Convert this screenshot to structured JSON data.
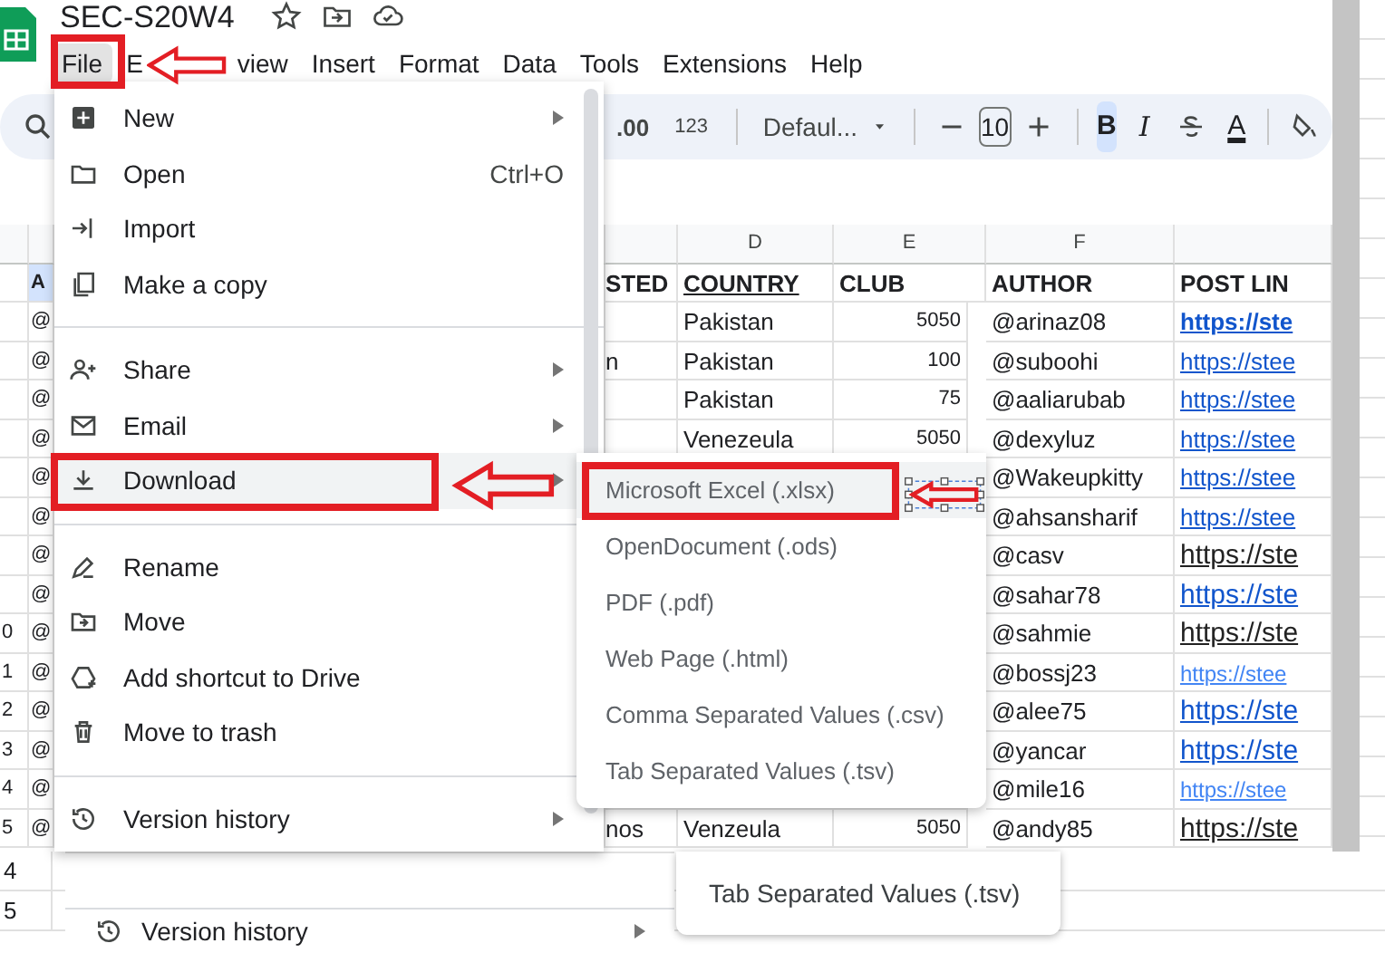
{
  "app": {
    "title": "SEC-S20W4"
  },
  "menu_bar": [
    {
      "label": "File",
      "selected": true
    },
    {
      "label": "E",
      "selected": false
    },
    {
      "label": "view",
      "selected": false
    },
    {
      "label": "Insert",
      "selected": false
    },
    {
      "label": "Format",
      "selected": false
    },
    {
      "label": "Data",
      "selected": false
    },
    {
      "label": "Tools",
      "selected": false
    },
    {
      "label": "Extensions",
      "selected": false
    },
    {
      "label": "Help",
      "selected": false
    }
  ],
  "toolbar": {
    "decimal_label": ".00",
    "number_format": "123",
    "font": "Defaul...",
    "font_size": "10",
    "bold": {
      "label": "B",
      "on": true
    },
    "italic_label": "I",
    "text_color_label": "A"
  },
  "sheet": {
    "columns": [
      "D",
      "E",
      "F"
    ],
    "header": {
      "a": "A",
      "c": "STED",
      "d": "COUNTRY",
      "e": "CLUB",
      "f": "AUTHOR",
      "g": "POST LIN"
    },
    "rows": [
      {
        "a": "@",
        "d": "Pakistan",
        "e": "5050",
        "f": "@arinaz08",
        "g": "https://ste",
        "kind": "bold-link"
      },
      {
        "a": "@",
        "c": "n",
        "d": "Pakistan",
        "e": "100",
        "f": "@suboohi",
        "g": "https://stee",
        "kind": "link"
      },
      {
        "a": "@",
        "d": "Pakistan",
        "e": "75",
        "f": "@aaliarubab",
        "g": "https://stee",
        "kind": "link"
      },
      {
        "a": "@",
        "d": "Venezeula",
        "e": "5050",
        "f": "@dexyluz",
        "g": "https://stee",
        "kind": "link"
      },
      {
        "a": "@",
        "f": "@Wakeupkitty",
        "g": "https://stee",
        "kind": "link"
      },
      {
        "a": "@",
        "f": "@ahsansharif",
        "g": "https://stee",
        "kind": "link"
      },
      {
        "a": "@",
        "f": "@casv",
        "g": "https://ste",
        "kind": "large-dark"
      },
      {
        "a": "@",
        "f": "@sahar78",
        "g": "https://ste",
        "kind": "large-link"
      },
      {
        "a": "@",
        "row_num": "0",
        "f": "@sahmie",
        "g": "https://ste",
        "kind": "large-dark"
      },
      {
        "a": "@",
        "row_num": "1",
        "f": "@bossj23",
        "g": "https://stee",
        "kind": "small-link"
      },
      {
        "a": "@",
        "row_num": "2",
        "f": "@alee75",
        "g": "https://ste",
        "kind": "large-link"
      },
      {
        "a": "@",
        "row_num": "3",
        "f": "@yancar",
        "g": "https://ste",
        "kind": "large-link"
      },
      {
        "a": "@",
        "row_num": "4",
        "f": "@mile16",
        "g": "https://stee",
        "kind": "small-link"
      },
      {
        "a": "@",
        "row_num": "5",
        "c": "nos",
        "d": "Venzeula",
        "e": "5050",
        "f": "@andy85",
        "g": "https://ste",
        "kind": "large-dark"
      }
    ]
  },
  "file_menu": {
    "items": [
      {
        "kind": "item",
        "label": "New",
        "has_submenu": true,
        "highlighted": false
      },
      {
        "kind": "item",
        "label": "Open",
        "shortcut": "Ctrl+O",
        "has_submenu": false,
        "highlighted": false
      },
      {
        "kind": "item",
        "label": "Import",
        "has_submenu": false,
        "highlighted": false
      },
      {
        "kind": "item",
        "label": "Make a copy",
        "has_submenu": false,
        "highlighted": false
      },
      {
        "kind": "divider"
      },
      {
        "kind": "item",
        "label": "Share",
        "has_submenu": true,
        "highlighted": false
      },
      {
        "kind": "item",
        "label": "Email",
        "has_submenu": true,
        "highlighted": false
      },
      {
        "kind": "item",
        "label": "Download",
        "has_submenu": true,
        "highlighted": true
      },
      {
        "kind": "divider"
      },
      {
        "kind": "item",
        "label": "Rename",
        "has_submenu": false,
        "highlighted": false
      },
      {
        "kind": "item",
        "label": "Move",
        "has_submenu": false,
        "highlighted": false
      },
      {
        "kind": "item",
        "label": "Add shortcut to Drive",
        "has_submenu": false,
        "highlighted": false
      },
      {
        "kind": "item",
        "label": "Move to trash",
        "has_submenu": false,
        "highlighted": false
      },
      {
        "kind": "divider"
      },
      {
        "kind": "item",
        "label": "Version history",
        "has_submenu": true,
        "highlighted": false
      }
    ]
  },
  "download_menu": {
    "items": [
      {
        "label": "Microsoft Excel (.xlsx)",
        "highlighted": true
      },
      {
        "label": "OpenDocument (.ods)",
        "highlighted": false
      },
      {
        "label": "PDF (.pdf)",
        "highlighted": false
      },
      {
        "label": "Web Page (.html)",
        "highlighted": false
      },
      {
        "label": "Comma Separated Values (.csv)",
        "highlighted": false
      },
      {
        "label": "Tab Separated Values (.tsv)",
        "highlighted": false
      }
    ]
  },
  "lower_capture": {
    "row_numbers": [
      "4",
      "5"
    ],
    "menu_item": "Version history",
    "submenu_item": "Tab Separated Values (.tsv)"
  }
}
